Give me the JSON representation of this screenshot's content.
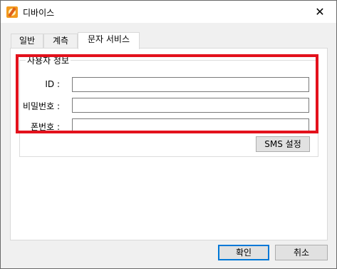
{
  "window": {
    "title": "디바이스",
    "close_glyph": "✕"
  },
  "tabs": [
    {
      "label": "일반"
    },
    {
      "label": "계측"
    },
    {
      "label": "문자 서비스"
    }
  ],
  "user_info": {
    "group_label": "사용자 정보",
    "fields": [
      {
        "label": "ID :",
        "value": ""
      },
      {
        "label": "비밀번호 :",
        "value": ""
      },
      {
        "label": "폰번호 :",
        "value": ""
      }
    ]
  },
  "buttons": {
    "sms_settings": "SMS 설정",
    "ok": "확인",
    "cancel": "취소"
  },
  "icons": {
    "app": "device-app-icon",
    "close": "close-icon"
  },
  "colors": {
    "highlight": "#e3111c",
    "default_button_border": "#0078d7"
  }
}
